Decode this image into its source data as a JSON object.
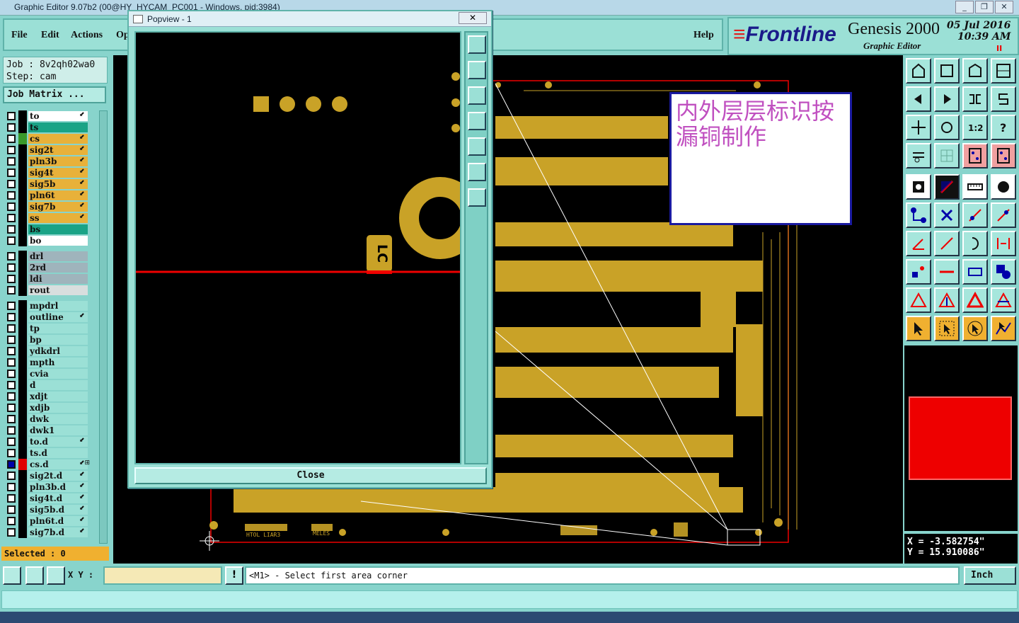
{
  "window": {
    "title": "Graphic Editor 9.07b2 (00@HY_HYCAM_PC001 - Windows, pid:3984)",
    "buttons": [
      "_",
      "❐",
      "✕"
    ]
  },
  "menu": {
    "file": "File",
    "edit": "Edit",
    "actions": "Actions",
    "options": "Op",
    "help": "Help"
  },
  "logo": {
    "brand_a": "≡",
    "brand": "Frontline",
    "product": "Genesis 2000",
    "subtitle": "Graphic Editor",
    "date": "05 Jul 2016",
    "time": "10:39 AM",
    "pause": "II"
  },
  "job": {
    "job_label": "Job : 8v2qh02wa0",
    "step_label": "Step: cam",
    "matrix_button": "Job Matrix ..."
  },
  "layers": [
    {
      "name": "to",
      "color": "#ffffff",
      "swatch": "#000000",
      "icon": "⬋"
    },
    {
      "name": "ts",
      "color": "#1aa386",
      "swatch": "#000000",
      "icon": ""
    },
    {
      "name": "cs",
      "color": "#e8b13a",
      "swatch": "#3a9a2a",
      "icon": "⬋"
    },
    {
      "name": "sig2t",
      "color": "#e8b13a",
      "swatch": "#000000",
      "icon": "⬋"
    },
    {
      "name": "pln3b",
      "color": "#e8b13a",
      "swatch": "#000000",
      "icon": "⬋"
    },
    {
      "name": "sig4t",
      "color": "#e8b13a",
      "swatch": "#000000",
      "icon": "⬋"
    },
    {
      "name": "sig5b",
      "color": "#e8b13a",
      "swatch": "#000000",
      "icon": "⬋"
    },
    {
      "name": "pln6t",
      "color": "#e8b13a",
      "swatch": "#000000",
      "icon": "⬋"
    },
    {
      "name": "sig7b",
      "color": "#e8b13a",
      "swatch": "#000000",
      "icon": "⬋"
    },
    {
      "name": "ss",
      "color": "#e8b13a",
      "swatch": "#000000",
      "icon": "⬋"
    },
    {
      "name": "bs",
      "color": "#1aa386",
      "swatch": "#000000",
      "icon": ""
    },
    {
      "name": "bo",
      "color": "#ffffff",
      "swatch": "#000000",
      "icon": ""
    },
    {
      "name": "drl",
      "color": "#9fb4bc",
      "swatch": "#000000",
      "icon": ""
    },
    {
      "name": "2rd",
      "color": "#9fb4bc",
      "swatch": "#000000",
      "icon": ""
    },
    {
      "name": "ldi",
      "color": "#9fb4bc",
      "swatch": "#000000",
      "icon": ""
    },
    {
      "name": "rout",
      "color": "#d8dede",
      "swatch": "#000000",
      "icon": ""
    },
    {
      "name": "mpdrl",
      "color": "#9be0d6",
      "swatch": "#000000",
      "icon": ""
    },
    {
      "name": "outline",
      "color": "#9be0d6",
      "swatch": "#000000",
      "icon": "⬋"
    },
    {
      "name": "tp",
      "color": "#9be0d6",
      "swatch": "#000000",
      "icon": ""
    },
    {
      "name": "bp",
      "color": "#9be0d6",
      "swatch": "#000000",
      "icon": ""
    },
    {
      "name": "ydkdrl",
      "color": "#9be0d6",
      "swatch": "#000000",
      "icon": ""
    },
    {
      "name": "mpth",
      "color": "#9be0d6",
      "swatch": "#000000",
      "icon": ""
    },
    {
      "name": "cvia",
      "color": "#9be0d6",
      "swatch": "#000000",
      "icon": ""
    },
    {
      "name": "d",
      "color": "#9be0d6",
      "swatch": "#000000",
      "icon": ""
    },
    {
      "name": "xdjt",
      "color": "#9be0d6",
      "swatch": "#000000",
      "icon": ""
    },
    {
      "name": "xdjb",
      "color": "#9be0d6",
      "swatch": "#000000",
      "icon": ""
    },
    {
      "name": "dwk",
      "color": "#9be0d6",
      "swatch": "#000000",
      "icon": ""
    },
    {
      "name": "dwk1",
      "color": "#9be0d6",
      "swatch": "#000000",
      "icon": ""
    },
    {
      "name": "to.d",
      "color": "#9be0d6",
      "swatch": "#000000",
      "icon": "⬋"
    },
    {
      "name": "ts.d",
      "color": "#9be0d6",
      "swatch": "#000000",
      "icon": ""
    },
    {
      "name": "cs.d",
      "color": "#9be0d6",
      "swatch": "#e00000",
      "icon": "⬋⊞"
    },
    {
      "name": "sig2t.d",
      "color": "#9be0d6",
      "swatch": "#000000",
      "icon": "⬋"
    },
    {
      "name": "pln3b.d",
      "color": "#9be0d6",
      "swatch": "#000000",
      "icon": "⬋"
    },
    {
      "name": "sig4t.d",
      "color": "#9be0d6",
      "swatch": "#000000",
      "icon": "⬋"
    },
    {
      "name": "sig5b.d",
      "color": "#9be0d6",
      "swatch": "#000000",
      "icon": "⬋"
    },
    {
      "name": "pln6t.d",
      "color": "#9be0d6",
      "swatch": "#000000",
      "icon": "⬋"
    },
    {
      "name": "sig7b.d",
      "color": "#9be0d6",
      "swatch": "#000000",
      "icon": "⬋"
    }
  ],
  "selected": "Selected : 0",
  "popup": {
    "title": "Popview - 1",
    "close_x": "✕",
    "close_label": "Close",
    "part_text": "LC"
  },
  "annotation": {
    "text": "内外层层标识按漏铜制作"
  },
  "board": {
    "silk_left": "HTOL LIAR3",
    "silk_mid": "MELES",
    "copper": "#c9a227",
    "outline": "#e00000"
  },
  "coords": {
    "x": "X = -3.582754\"",
    "y": "Y = 15.910086\""
  },
  "bottom": {
    "xy_label": "X Y :",
    "xy_value": "",
    "message": "<M1> - Select first area corner",
    "unit": "Inch"
  },
  "colors": {
    "panel": "#88d4cc",
    "accent": "#1a1aa0"
  }
}
